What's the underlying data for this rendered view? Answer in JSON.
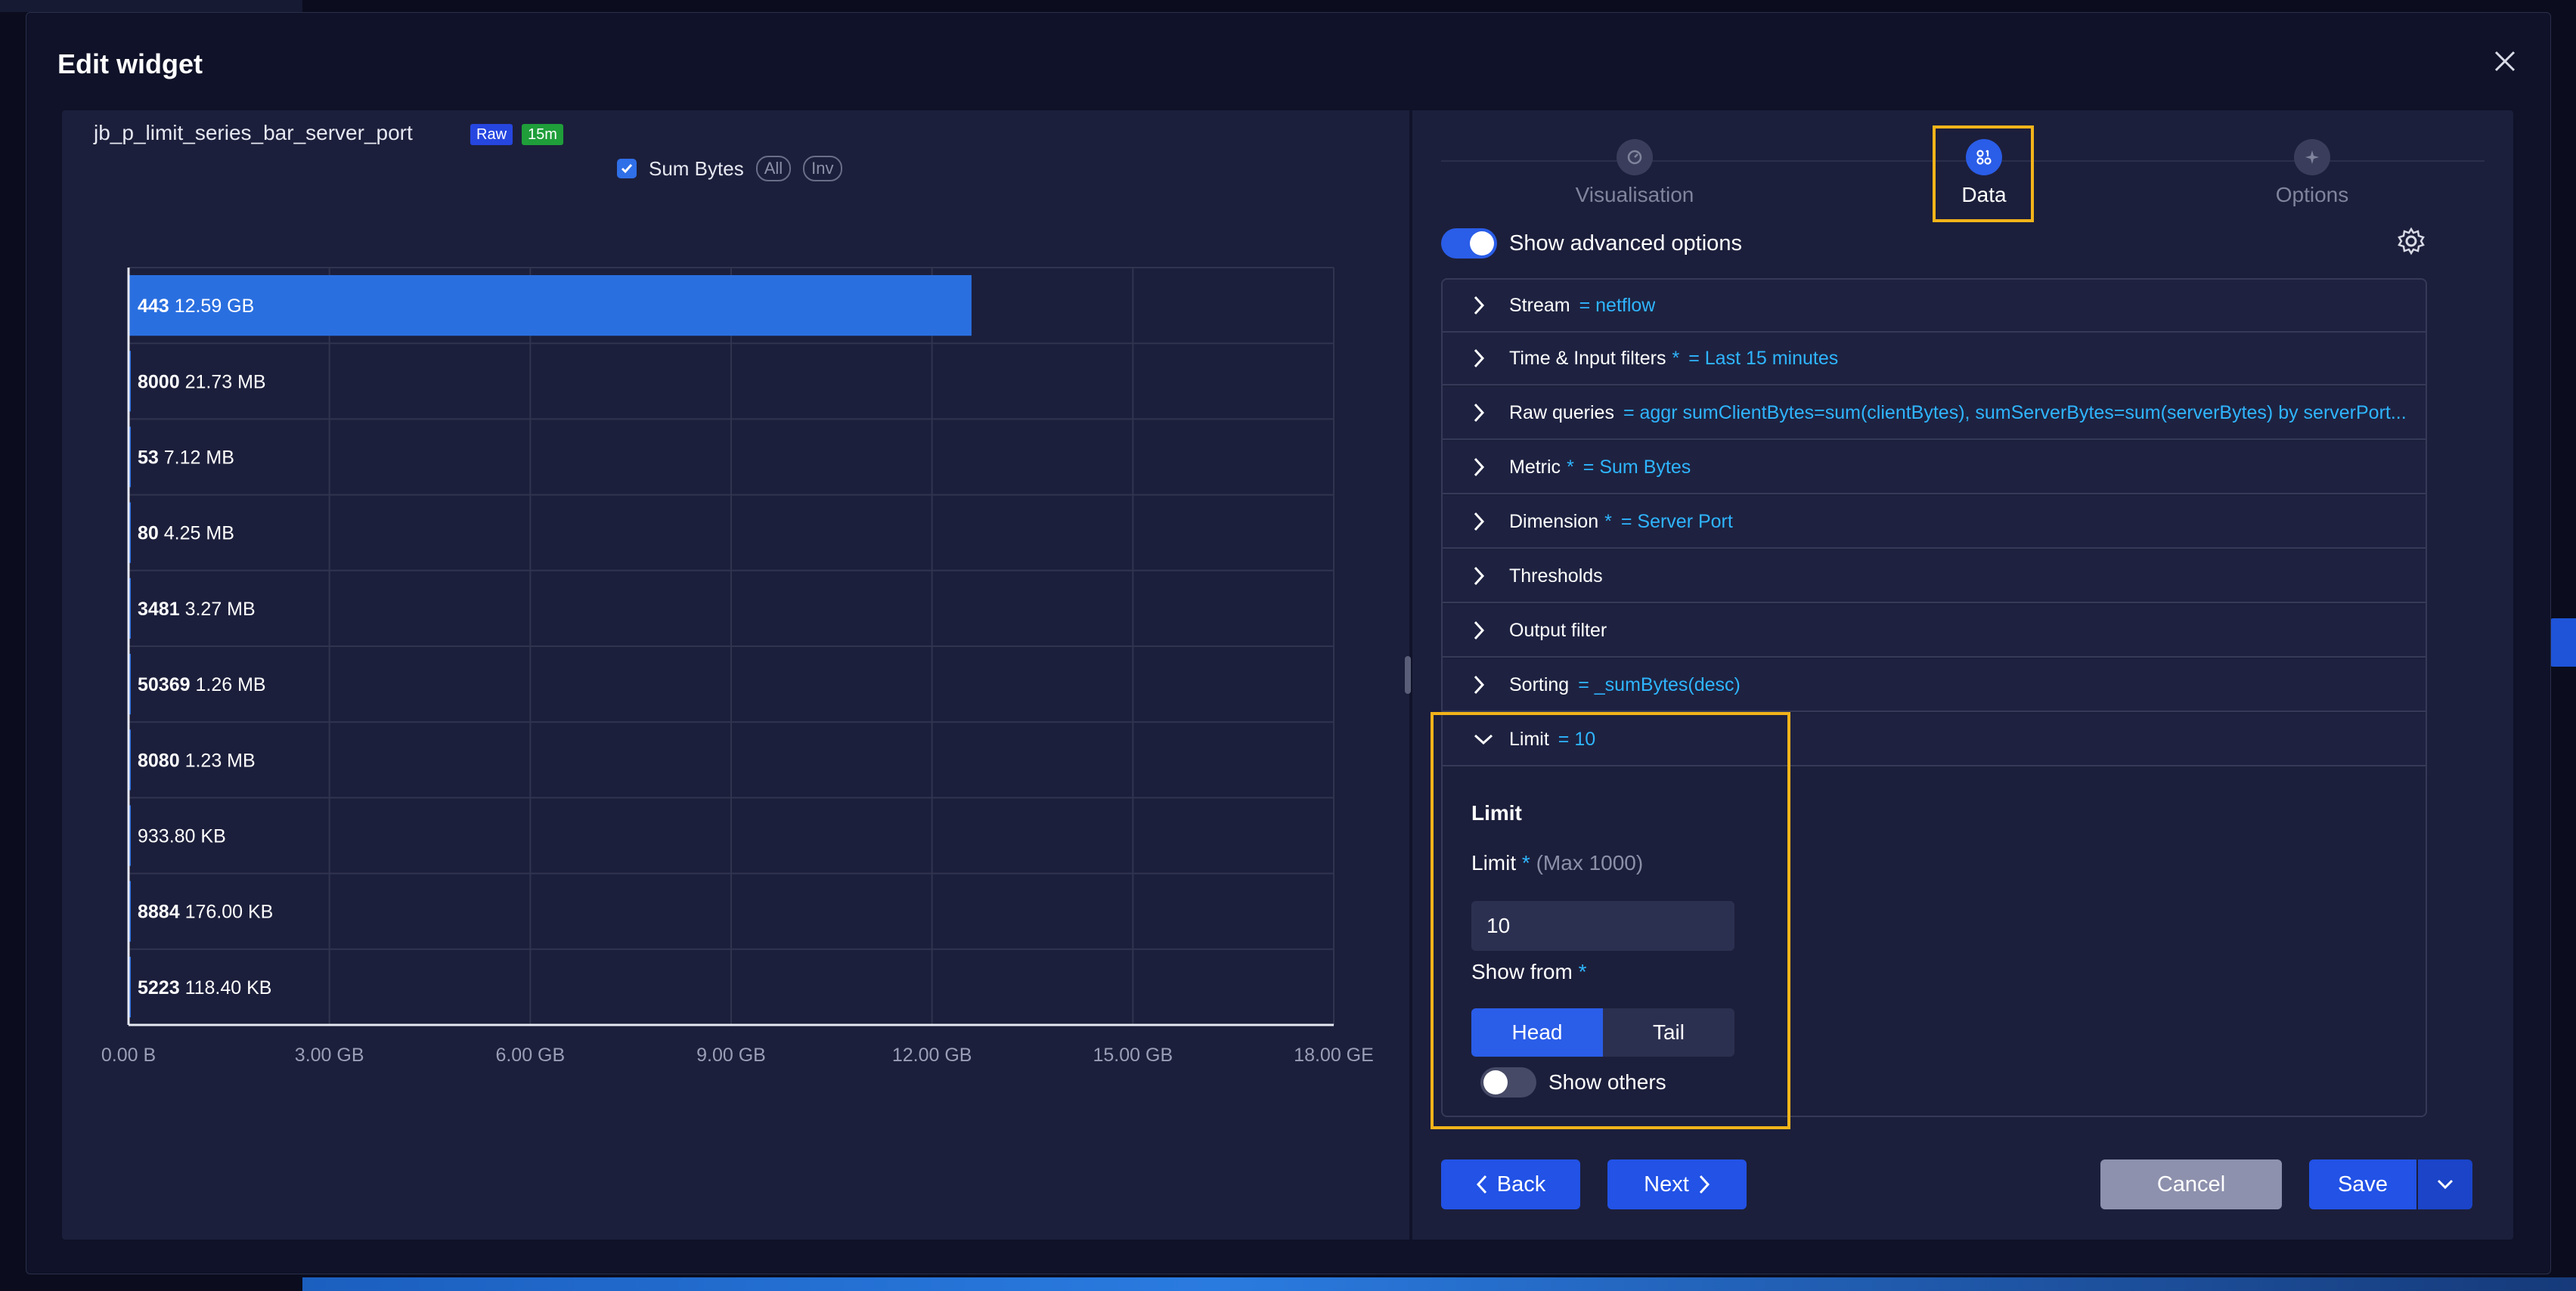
{
  "modal": {
    "title": "Edit widget"
  },
  "widget": {
    "name": "jb_p_limit_series_bar_server_port",
    "badges": [
      {
        "label": "Raw",
        "color": "#2646e0"
      },
      {
        "label": "15m",
        "color": "#1f9e3a"
      }
    ],
    "legend": {
      "series_label": "Sum Bytes",
      "all": "All",
      "inv": "Inv"
    }
  },
  "chart_data": {
    "type": "bar",
    "orientation": "horizontal",
    "categories": [
      "443",
      "8000",
      "53",
      "80",
      "3481",
      "50369",
      "8080",
      "",
      "8884",
      "5223"
    ],
    "value_labels": [
      "12.59 GB",
      "21.73 MB",
      "7.12 MB",
      "4.25 MB",
      "3.27 MB",
      "1.26 MB",
      "1.23 MB",
      "933.80 KB",
      "176.00 KB",
      "118.40 KB"
    ],
    "values_gb": [
      12.59,
      0.02173,
      0.00712,
      0.00425,
      0.00327,
      0.00126,
      0.00123,
      0.0009338,
      0.000176,
      0.0001184
    ],
    "xlim": [
      0,
      18
    ],
    "x_ticks": [
      "0.00 B",
      "3.00 GB",
      "6.00 GB",
      "9.00 GB",
      "12.00 GB",
      "15.00 GB",
      "18.00 GE"
    ],
    "series": [
      {
        "name": "Sum Bytes",
        "color": "#2a6fe0"
      }
    ],
    "grid": true
  },
  "steps": [
    {
      "label": "Visualisation",
      "icon": "chart-icon",
      "active": false
    },
    {
      "label": "Data",
      "icon": "data-icon",
      "active": true
    },
    {
      "label": "Options",
      "icon": "sparkle-icon",
      "active": false
    }
  ],
  "advanced": {
    "label": "Show advanced options",
    "enabled": true
  },
  "sections": [
    {
      "label": "Stream",
      "required": false,
      "value": "= netflow",
      "expanded": false
    },
    {
      "label": "Time & Input filters",
      "required": true,
      "value": "= Last 15 minutes",
      "expanded": false
    },
    {
      "label": "Raw queries",
      "required": false,
      "value": "= aggr sumClientBytes=sum(clientBytes), sumServerBytes=sum(serverBytes) by serverPort...",
      "expanded": false
    },
    {
      "label": "Metric",
      "required": true,
      "value": "= Sum Bytes",
      "expanded": false
    },
    {
      "label": "Dimension",
      "required": true,
      "value": "= Server Port",
      "expanded": false
    },
    {
      "label": "Thresholds",
      "required": false,
      "value": "",
      "expanded": false
    },
    {
      "label": "Output filter",
      "required": false,
      "value": "",
      "expanded": false
    },
    {
      "label": "Sorting",
      "required": false,
      "value": "= _sumBytes(desc)",
      "expanded": false
    },
    {
      "label": "Limit",
      "required": false,
      "value": "= 10",
      "expanded": true
    }
  ],
  "limit_panel": {
    "title": "Limit",
    "limit_label": "Limit",
    "limit_hint": "(Max 1000)",
    "limit_value": "10",
    "show_from_label": "Show from",
    "head_label": "Head",
    "tail_label": "Tail",
    "show_others_label": "Show others",
    "show_others_enabled": false
  },
  "footer": {
    "back_label": "Back",
    "next_label": "Next",
    "cancel_label": "Cancel",
    "save_label": "Save"
  },
  "colors": {
    "accent": "#2252e6",
    "highlight": "#f2b41a",
    "value_text": "#2fb5ff"
  }
}
